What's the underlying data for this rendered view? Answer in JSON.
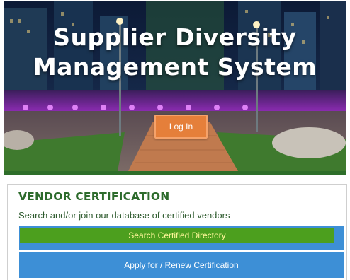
{
  "hero": {
    "title_line1": "Supplier Diversity",
    "title_line2": "Management System",
    "login_label": "Log In",
    "background_image": "night-plaza-illustration"
  },
  "vendor_certification": {
    "title": "VENDOR CERTIFICATION",
    "subtitle": "Search and/or join our database of certified vendors",
    "search_label": "Search Certified Directory",
    "apply_label": "Apply for / Renew Certification"
  },
  "colors": {
    "heading_green": "#2d6b2c",
    "accent_orange": "#e57f3a",
    "button_blue": "#3d8fd6",
    "button_green": "#4c9f1e",
    "search_text_yellow": "#fff79a"
  }
}
